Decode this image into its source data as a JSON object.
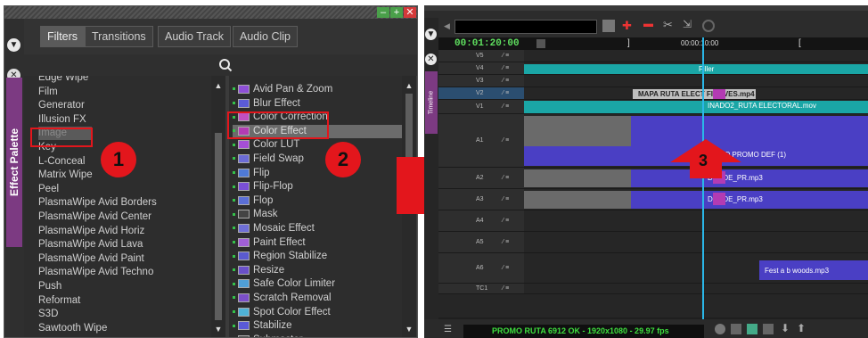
{
  "palette": {
    "vertical_title": "Effect Palette",
    "tabs": [
      "Filters",
      "Transitions",
      "Audio Track",
      "Audio Clip"
    ],
    "categories": [
      "Edge Wipe",
      "Film",
      "Generator",
      "Illusion FX",
      "Image",
      "Key",
      "L-Conceal",
      "Matrix Wipe",
      "Peel",
      "PlasmaWipe Avid Borders",
      "PlasmaWipe Avid Center",
      "PlasmaWipe Avid Horiz",
      "PlasmaWipe Avid Lava",
      "PlasmaWipe Avid Paint",
      "PlasmaWipe Avid Techno",
      "Push",
      "Reformat",
      "S3D",
      "Sawtooth Wipe"
    ],
    "selected_category": "Image",
    "effects": [
      {
        "label": "Avid Pan & Zoom",
        "color": "#8e4fd6"
      },
      {
        "label": "Blur Effect",
        "color": "#5b5bd6"
      },
      {
        "label": "Color Correction",
        "color": "#c14fc1"
      },
      {
        "label": "Color Effect",
        "color": "#b33bb3"
      },
      {
        "label": "Color LUT",
        "color": "#a54fd6"
      },
      {
        "label": "Field Swap",
        "color": "#6c6cd6"
      },
      {
        "label": "Flip",
        "color": "#4f7ad6"
      },
      {
        "label": "Flip-Flop",
        "color": "#7a4fd6"
      },
      {
        "label": "Flop",
        "color": "#5b6fd6"
      },
      {
        "label": "Mask",
        "color": "#444444"
      },
      {
        "label": "Mosaic Effect",
        "color": "#6f6fd6"
      },
      {
        "label": "Paint Effect",
        "color": "#a05fd6"
      },
      {
        "label": "Region Stabilize",
        "color": "#5a5ad0"
      },
      {
        "label": "Resize",
        "color": "#6a50c8"
      },
      {
        "label": "Safe Color Limiter",
        "color": "#4f9fd6"
      },
      {
        "label": "Scratch Removal",
        "color": "#7b4fc8"
      },
      {
        "label": "Spot Color Effect",
        "color": "#4fb2d6"
      },
      {
        "label": "Stabilize",
        "color": "#5a5ad6"
      },
      {
        "label": "Submaster",
        "color": "#555555"
      }
    ],
    "selected_effect": "Color Effect"
  },
  "badges": {
    "one": "1",
    "two": "2",
    "three": "3"
  },
  "timeline": {
    "vertical_title": "Timeline",
    "timecode": "00:01:20:00",
    "ruler_time": "00:00:10:00",
    "tracks": [
      "V5",
      "V4",
      "V3",
      "V2",
      "V1",
      "A1",
      "A2",
      "A3",
      "A4",
      "A5",
      "A6",
      "TC1"
    ],
    "clips": {
      "filler": "Filler",
      "v2": "MAPA RUTA ELECT  FIL - VES.mp4",
      "v1": "INADO2_RUTA ELECTORAL.mov",
      "a1": "AUDIO PROMO DEF (1)",
      "a2": "DEODE_PR.mp3",
      "a3": "DEODE_PR.mp3",
      "a5": "Fest a  b woods.mp3"
    },
    "status": "PROMO RUTA 6912 OK - 1920x1080 - 29.97 fps"
  },
  "colors": {
    "accent_red": "#e3161c",
    "timeline_teal": "#1aa6a6",
    "timeline_purple": "#5a3fd6",
    "playhead": "#2ab7e8"
  }
}
